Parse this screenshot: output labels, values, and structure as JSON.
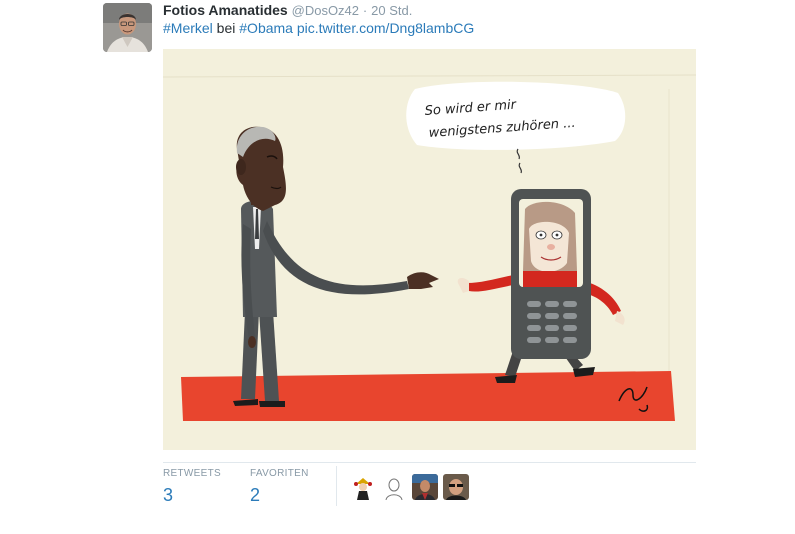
{
  "tweet": {
    "author_name": "Fotios Amanatides",
    "author_handle": "@DosOz42",
    "separator": "·",
    "timestamp": "20 Std.",
    "text_hashtag1": "#Merkel",
    "text_word": " bei ",
    "text_hashtag2": "#Obama",
    "text_space": " ",
    "text_link": "pic.twitter.com/Dng8lambCG"
  },
  "cartoon": {
    "speech": [
      "So wird er mir",
      "wenigstens zuhören ..."
    ]
  },
  "stats": {
    "retweets_label": "RETWEETS",
    "retweets_value": "3",
    "favorites_label": "FAVORITEN",
    "favorites_value": "2"
  },
  "favoriters": [
    {
      "icon": "avatar-jester"
    },
    {
      "icon": "avatar-sketch"
    },
    {
      "icon": "avatar-photo-man"
    },
    {
      "icon": "avatar-photo-sunglasses"
    }
  ],
  "colors": {
    "link": "#2b7bb9",
    "carpet": "#e8452e",
    "background": "#f3f0dc"
  }
}
